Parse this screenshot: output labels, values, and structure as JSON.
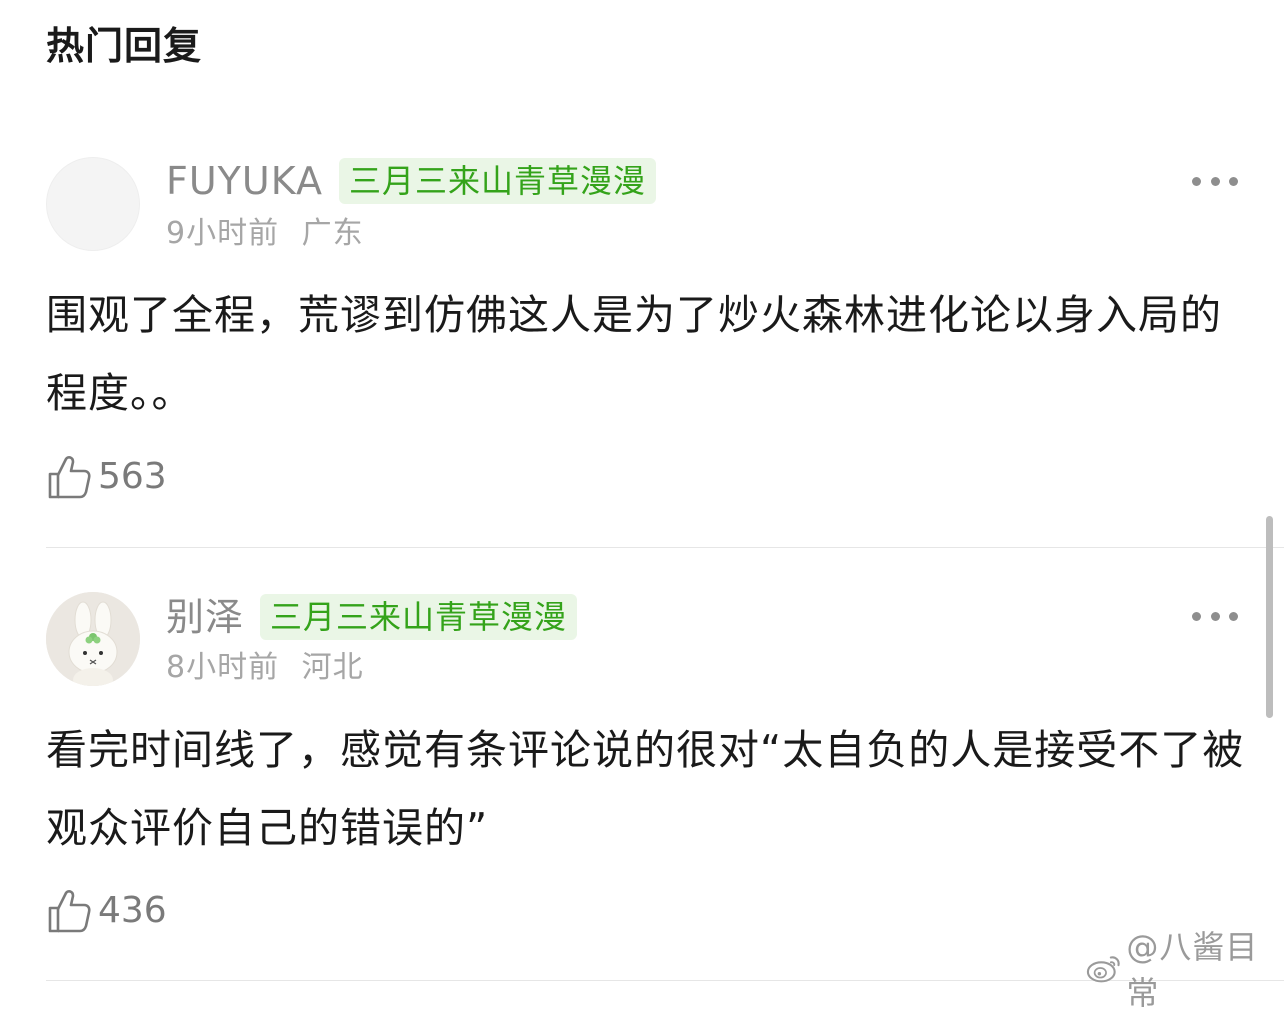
{
  "header": {
    "title": "热门回复"
  },
  "comments": [
    {
      "username": "FUYUKA",
      "badge": "三月三来山青草漫漫",
      "time": "9小时前",
      "location": "广东",
      "content": "围观了全程，荒谬到仿佛这人是为了炒火森林进化论以身入局的程度。。",
      "likes": "563",
      "avatar_icon": "blank-avatar"
    },
    {
      "username": "别泽",
      "badge": "三月三来山青草漫漫",
      "time": "8小时前",
      "location": "河北",
      "content": "看完时间线了，感觉有条评论说的很对“太自负的人是接受不了被观众评价自己的错误的”",
      "likes": "436",
      "avatar_icon": "bunny-plush-avatar"
    }
  ],
  "watermark": {
    "text": "@八酱目常",
    "icon": "weibo-icon"
  },
  "colors": {
    "badge_bg": "#eaf6e6",
    "badge_text": "#34a31a",
    "username": "#8a8a8a",
    "meta": "#a6a6a6",
    "content": "#1a1a1a"
  }
}
